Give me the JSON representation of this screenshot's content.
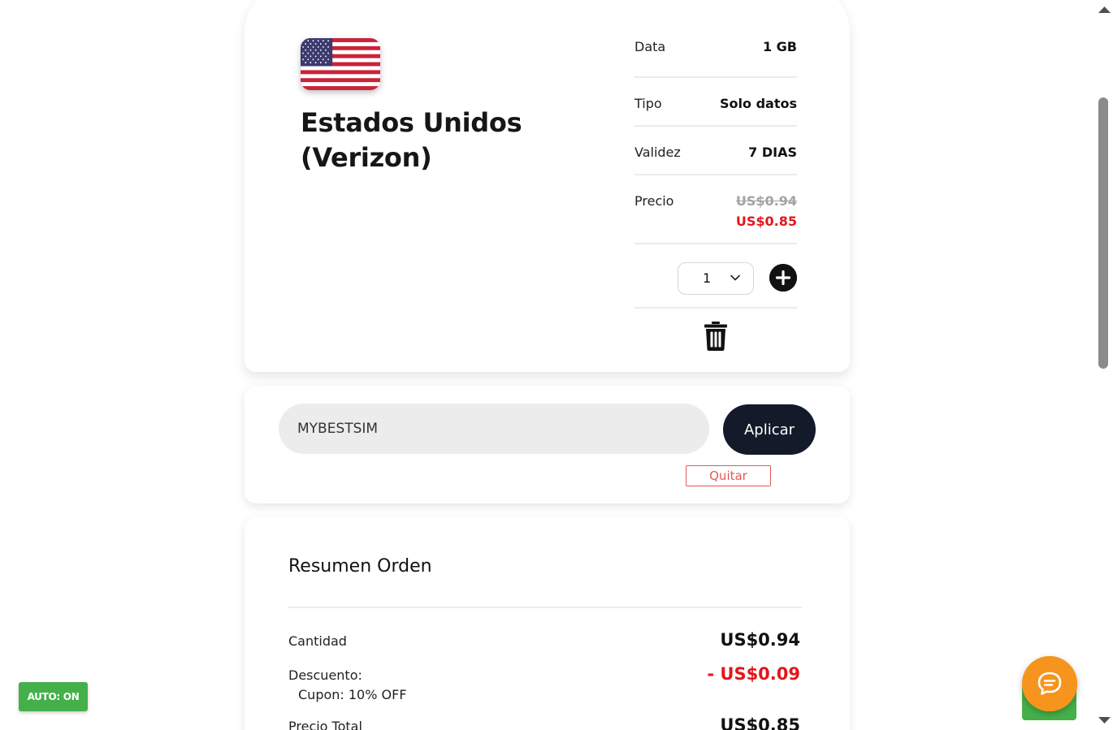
{
  "product": {
    "country": "Estados Unidos (Verizon)",
    "flag_icon": "us-flag-icon",
    "specs": {
      "data_label": "Data",
      "data_value": "1 GB",
      "type_label": "Tipo",
      "type_value": "Solo datos",
      "validity_label": "Validez",
      "validity_value": "7 DIAS",
      "price_label": "Precio",
      "price_original": "US$0.94",
      "price_discounted": "US$0.85"
    },
    "quantity": "1",
    "plus_icon": "plus-circle-icon",
    "trash_icon": "trash-icon"
  },
  "coupon": {
    "code_value": "MYBESTSIM",
    "apply_label": "Aplicar",
    "remove_label": "Quitar"
  },
  "summary": {
    "title": "Resumen Orden",
    "quantity_label": "Cantidad",
    "quantity_value": "US$0.94",
    "discount_label": "Descuento:",
    "discount_value": "- US$0.09",
    "coupon_note": "Cupon: 10% OFF",
    "total_label": "Precio Total",
    "total_value": "US$0.85"
  },
  "widgets": {
    "auto_badge": "AUTO: ON",
    "chat_icon": "chat-bubble-icon"
  },
  "colors": {
    "accent_red": "#e3161b",
    "dark_button": "#131a2a",
    "chat_orange": "#f7941d",
    "badge_green": "#45b04a"
  }
}
